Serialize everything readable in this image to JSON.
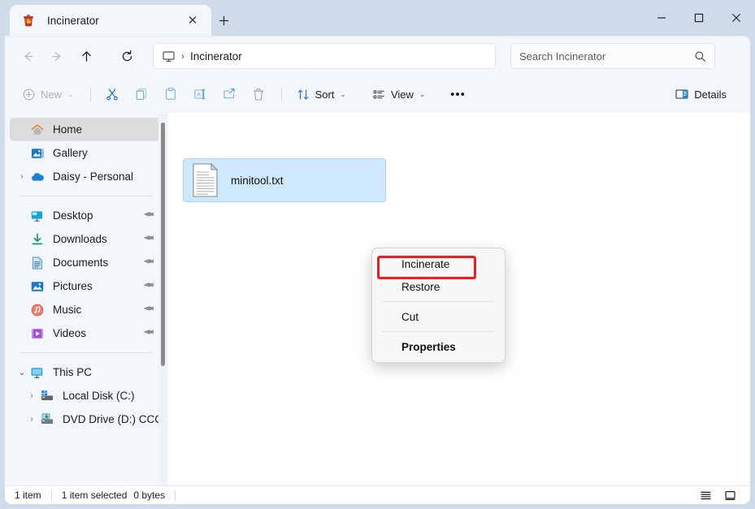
{
  "window": {
    "tab_title": "Incinerator",
    "tab_icon": "incinerator-bin-icon",
    "tab_close_glyph": "✕",
    "new_tab_glyph": "＋",
    "minimize_glyph": "─",
    "maximize_glyph": "☐",
    "close_glyph": "✕"
  },
  "nav": {
    "back_glyph": "←",
    "forward_glyph": "→",
    "up_glyph": "↑",
    "refresh_glyph": "↻",
    "address": {
      "root_icon": "this-pc-monitor-icon",
      "separator": "›",
      "current": "Incinerator"
    },
    "search": {
      "placeholder": "Search Incinerator",
      "icon": "search-icon"
    }
  },
  "toolbar": {
    "new_label": "New",
    "new_icon": "plus-circle-icon",
    "cut_icon": "scissors-icon",
    "copy_icon": "copy-icon",
    "paste_icon": "paste-icon",
    "rename_icon": "rename-icon",
    "share_icon": "share-icon",
    "delete_icon": "trash-icon",
    "sort_label": "Sort",
    "sort_icon": "sort-arrows-icon",
    "view_label": "View",
    "view_icon": "view-list-icon",
    "more_label": "•••",
    "details_label": "Details",
    "details_icon": "details-pane-icon",
    "chevron": "⌄"
  },
  "sidebar": {
    "items": [
      {
        "label": "Home",
        "icon": "home-icon",
        "selected": true,
        "expandable": false,
        "pinned": false
      },
      {
        "label": "Gallery",
        "icon": "gallery-icon",
        "selected": false,
        "expandable": false,
        "pinned": false
      },
      {
        "label": "Daisy - Personal",
        "icon": "onedrive-icon",
        "selected": false,
        "expandable": true,
        "pinned": false
      },
      {
        "divider": true
      },
      {
        "label": "Desktop",
        "icon": "desktop-icon",
        "selected": false,
        "expandable": false,
        "pinned": true
      },
      {
        "label": "Downloads",
        "icon": "downloads-icon",
        "selected": false,
        "expandable": false,
        "pinned": true
      },
      {
        "label": "Documents",
        "icon": "documents-icon",
        "selected": false,
        "expandable": false,
        "pinned": true
      },
      {
        "label": "Pictures",
        "icon": "pictures-icon",
        "selected": false,
        "expandable": false,
        "pinned": true
      },
      {
        "label": "Music",
        "icon": "music-icon",
        "selected": false,
        "expandable": false,
        "pinned": true
      },
      {
        "label": "Videos",
        "icon": "videos-icon",
        "selected": false,
        "expandable": false,
        "pinned": true
      },
      {
        "divider": true
      },
      {
        "label": "This PC",
        "icon": "this-pc-icon",
        "selected": false,
        "expanded": true,
        "pinned": false
      },
      {
        "label": "Local Disk (C:)",
        "icon": "disk-icon",
        "selected": false,
        "expandable": true,
        "pinned": false,
        "indent": true
      },
      {
        "label": "DVD Drive (D:) CCCOM",
        "icon": "dvd-icon",
        "selected": false,
        "expandable": true,
        "pinned": false,
        "indent": true
      }
    ],
    "chevron_collapsed": "›",
    "chevron_expanded": "⌄",
    "pin_glyph": "📌"
  },
  "files": [
    {
      "name": "minitool.txt",
      "icon": "text-file-icon",
      "selected": true
    }
  ],
  "context_menu": {
    "items": [
      {
        "label": "Incinerate",
        "bold": false,
        "highlighted": true
      },
      {
        "label": "Restore",
        "bold": false,
        "highlighted": false
      },
      {
        "separator": true
      },
      {
        "label": "Cut",
        "bold": false,
        "highlighted": false
      },
      {
        "separator": true
      },
      {
        "label": "Properties",
        "bold": true,
        "highlighted": false
      }
    ],
    "highlight_color": "#ee1c25"
  },
  "statusbar": {
    "item_count": "1 item",
    "selection": "1 item selected",
    "size": "0 bytes",
    "details_view_icon": "details-view-icon",
    "large_icons_view_icon": "large-icons-view-icon"
  },
  "colors": {
    "titlebar": "#cfdbe9",
    "chrome": "#f3f7fb",
    "content": "#ffffff",
    "selection": "#cfe8fb",
    "sidebar_selected": "#dcdcdc",
    "accent": "#0f6cbd",
    "red_highlight": "#ee1c25"
  }
}
